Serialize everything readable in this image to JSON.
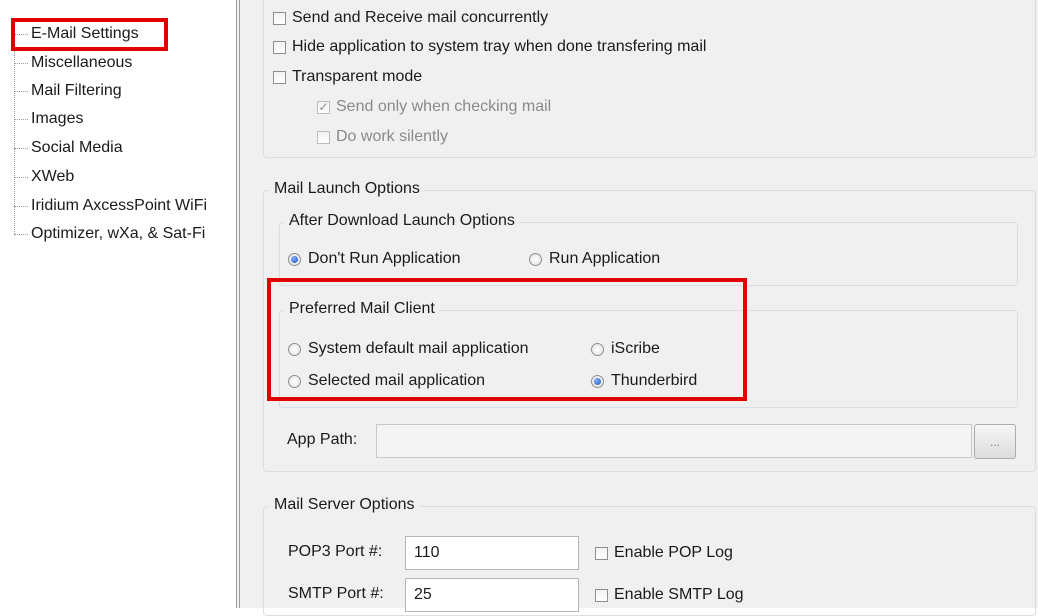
{
  "tree": {
    "items": [
      {
        "label": "E-Mail Settings"
      },
      {
        "label": "Miscellaneous"
      },
      {
        "label": "Mail Filtering"
      },
      {
        "label": "Images"
      },
      {
        "label": "Social Media"
      },
      {
        "label": "XWeb"
      },
      {
        "label": "Iridium AxcessPoint WiFi"
      },
      {
        "label": "Optimizer, wXa, & Sat-Fi"
      }
    ]
  },
  "general": {
    "send_receive_concurrently": "Send and Receive mail concurrently",
    "hide_to_tray": "Hide application to system tray when done transfering mail",
    "transparent_mode": "Transparent mode",
    "send_only_when_checking": "Send only when checking mail",
    "do_work_silently": "Do work silently",
    "check_glyph": "✓"
  },
  "launch": {
    "group_title": "Mail Launch Options",
    "after_download": {
      "title": "After Download Launch Options",
      "dont_run": "Don't Run Application",
      "run": "Run Application"
    },
    "preferred": {
      "title": "Preferred Mail Client",
      "system_default": "System default mail application",
      "iscribe": "iScribe",
      "selected": "Selected mail application",
      "thunderbird": "Thunderbird"
    },
    "app_path_label": "App Path:",
    "app_path_value": "",
    "browse_label": "..."
  },
  "server": {
    "group_title": "Mail Server Options",
    "pop3_label": "POP3 Port #:",
    "pop3_value": "110",
    "pop_log": "Enable POP Log",
    "smtp_label": "SMTP Port #:",
    "smtp_value": "25",
    "smtp_log": "Enable SMTP Log"
  },
  "colors": {
    "highlight": "#e00000",
    "panel_bg": "#f0f0f0"
  }
}
